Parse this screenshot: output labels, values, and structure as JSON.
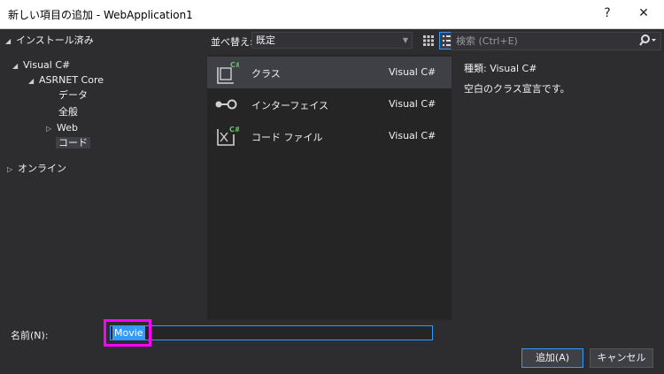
{
  "window": {
    "title": "新しい項目の追加 - WebApplication1",
    "help_label": "?",
    "close_label": "✕"
  },
  "tree": {
    "installed": "インストール済み",
    "visual_csharp": "Visual C#",
    "aspnet_core": "ASRNET Core",
    "data": "データ",
    "general": "全般",
    "web": "Web",
    "code": "コード",
    "online": "オンライン",
    "expanded_glyph": "◢",
    "collapsed_glyph": "▷"
  },
  "toolbar": {
    "sort_label": "並べ替え:",
    "sort_value": "既定",
    "search_placeholder": "検索 (Ctrl+E)"
  },
  "templates": [
    {
      "name": "クラス",
      "lang": "Visual C#",
      "icon": "class-icon"
    },
    {
      "name": "インターフェイス",
      "lang": "Visual C#",
      "icon": "interface-icon"
    },
    {
      "name": "コード ファイル",
      "lang": "Visual C#",
      "icon": "code-file-icon"
    }
  ],
  "details": {
    "type_label": "種類:",
    "type_value": "Visual C#",
    "description": "空白のクラス宣言です。"
  },
  "form": {
    "name_label": "名前(N):",
    "name_value": "Movie"
  },
  "buttons": {
    "add": "追加(A)",
    "cancel": "キャンセル"
  },
  "colors": {
    "accent": "#3399ff",
    "highlight": "#ff00ff",
    "badge": "#68c26b"
  }
}
